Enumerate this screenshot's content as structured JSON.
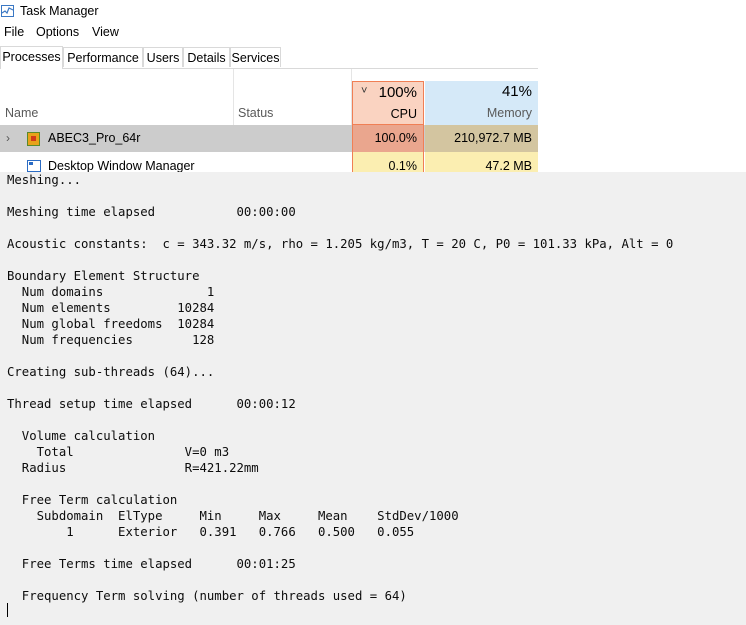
{
  "task_manager": {
    "title": "Task Manager",
    "menu": [
      "File",
      "Options",
      "View"
    ],
    "tabs": [
      "Processes",
      "Performance",
      "Users",
      "Details",
      "Services"
    ],
    "active_tab": "Processes",
    "columns": {
      "name": "Name",
      "status": "Status",
      "cpu": {
        "percent": "100%",
        "label": "CPU"
      },
      "memory": {
        "percent": "41%",
        "label": "Memory"
      }
    },
    "rows": [
      {
        "name": "ABEC3_Pro_64r",
        "cpu": "100.0%",
        "memory": "210,972.7 MB"
      },
      {
        "name": "Desktop Window Manager",
        "cpu": "0.1%",
        "memory": "47.2 MB"
      }
    ],
    "colors": {
      "cpu_header": "#fad3c1",
      "cpu_border": "#f07f55",
      "memory_header": "#d5e9f8",
      "selected_row": "#cccccc"
    }
  },
  "console": {
    "lines": [
      "Meshing...",
      "",
      "Meshing time elapsed           00:00:00",
      "",
      "Acoustic constants:  c = 343.32 m/s, rho = 1.205 kg/m3, T = 20 C, P0 = 101.33 kPa, Alt = 0",
      "",
      "Boundary Element Structure",
      "  Num domains              1",
      "  Num elements         10284",
      "  Num global freedoms  10284",
      "  Num frequencies        128",
      "",
      "Creating sub-threads (64)...",
      "",
      "Thread setup time elapsed      00:00:12",
      "",
      "  Volume calculation",
      "    Total               V=0 m3",
      "  Radius                R=421.22mm",
      "",
      "  Free Term calculation",
      "    Subdomain  ElType     Min     Max     Mean    StdDev/1000",
      "        1      Exterior   0.391   0.766   0.500   0.055",
      "",
      "  Free Terms time elapsed      00:01:25",
      "",
      "  Frequency Term solving (number of threads used = 64)"
    ]
  }
}
